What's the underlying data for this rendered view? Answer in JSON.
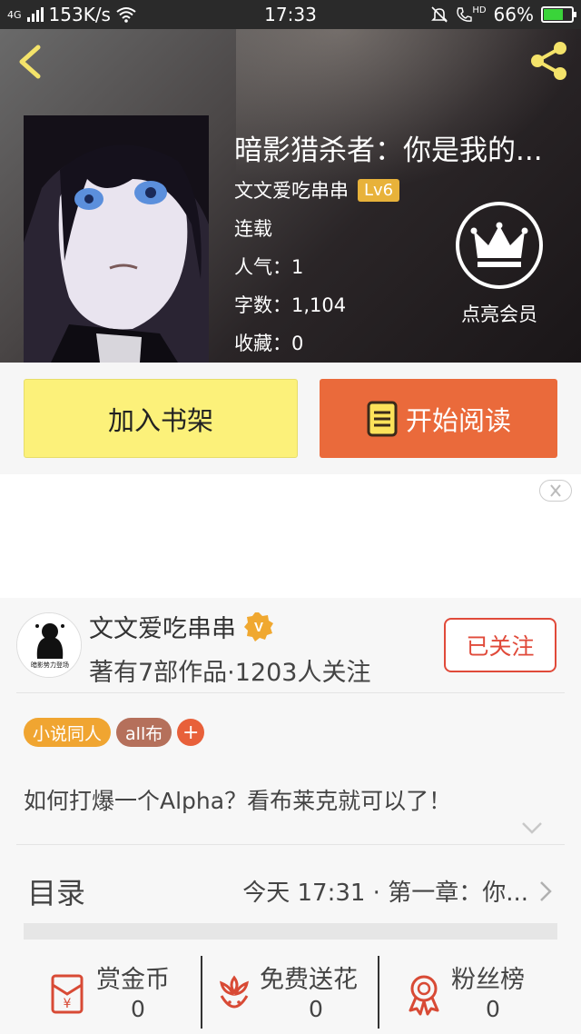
{
  "status_bar": {
    "network": "4G",
    "speed": "153K/s",
    "time": "17:33",
    "hd": "HD",
    "battery": "66%",
    "battery_level": 0.66
  },
  "book": {
    "title": "暗影猎杀者：你是我的...",
    "author": "文文爱吃串串",
    "level": "Lv6",
    "status": "连载",
    "popularity": "人气：1",
    "word_count": "字数：1,104",
    "favorites": "收藏：0",
    "vip_label": "点亮会员"
  },
  "actions": {
    "add_shelf": "加入书架",
    "start_read": "开始阅读"
  },
  "author_card": {
    "name": "文文爱吃串串",
    "v_badge": "V",
    "stats": "著有7部作品·1203人关注",
    "follow_label": "已关注",
    "avatar_text": "暗影势力登场",
    "tags": [
      "小说同人",
      "all布"
    ],
    "tag_add": "+",
    "synopsis": "如何打爆一个Alpha？看布莱克就可以了！"
  },
  "toc": {
    "label": "目录",
    "latest": "今天 17:31 · 第一章：你..."
  },
  "bottom": {
    "reward_label": "赏金币",
    "reward_value": "0",
    "flower_label": "免费送花",
    "flower_value": "0",
    "fans_label": "粉丝榜",
    "fans_value": "0"
  },
  "colors": {
    "shelf_button": "#fcf17a",
    "read_button": "#ea6a3b",
    "follow_accent": "#e04a3a",
    "tag1": "#f0a531",
    "tag2": "#b5705b",
    "level_badge": "#e8b23a",
    "icon_red": "#d84a35"
  }
}
